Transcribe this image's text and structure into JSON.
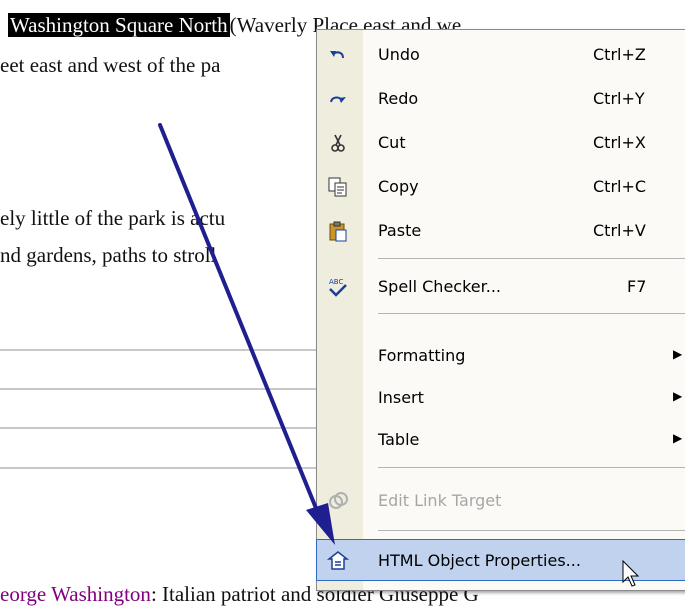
{
  "document": {
    "line1_selected": "Washington Square North",
    "line1_rest": "(Waverly Place east and we",
    "line2": "eet east and west of the pa",
    "line3": "ely little of the park is actu",
    "line4": "nd gardens, paths to stroll",
    "bottom_line_purple": "eorge Washington",
    "bottom_line_rest": ": Italian patriot and soldier Giuseppe G"
  },
  "context_menu": {
    "items": [
      {
        "label": "Undo",
        "shortcut": "Ctrl+Z",
        "icon": "undo-icon"
      },
      {
        "label": "Redo",
        "shortcut": "Ctrl+Y",
        "icon": "redo-icon"
      },
      {
        "label": "Cut",
        "shortcut": "Ctrl+X",
        "icon": "scissors-icon"
      },
      {
        "label": "Copy",
        "shortcut": "Ctrl+C",
        "icon": "copy-icon"
      },
      {
        "label": "Paste",
        "shortcut": "Ctrl+V",
        "icon": "paste-icon"
      },
      {
        "label": "Spell Checker...",
        "shortcut": "F7",
        "icon": "spellcheck-icon"
      },
      {
        "label": "Formatting",
        "icon": "submenu-arrow-icon"
      },
      {
        "label": "Insert",
        "icon": "submenu-arrow-icon"
      },
      {
        "label": "Table",
        "icon": "submenu-arrow-icon"
      },
      {
        "label": "Edit Link Target",
        "icon": "link-icon",
        "disabled": true
      },
      {
        "label": "HTML Object Properties...",
        "icon": "properties-icon",
        "highlighted": true
      }
    ]
  },
  "colors": {
    "arrow": "#1f1f8f",
    "highlight": "#c1d2ee",
    "gutter": "#efedde"
  }
}
